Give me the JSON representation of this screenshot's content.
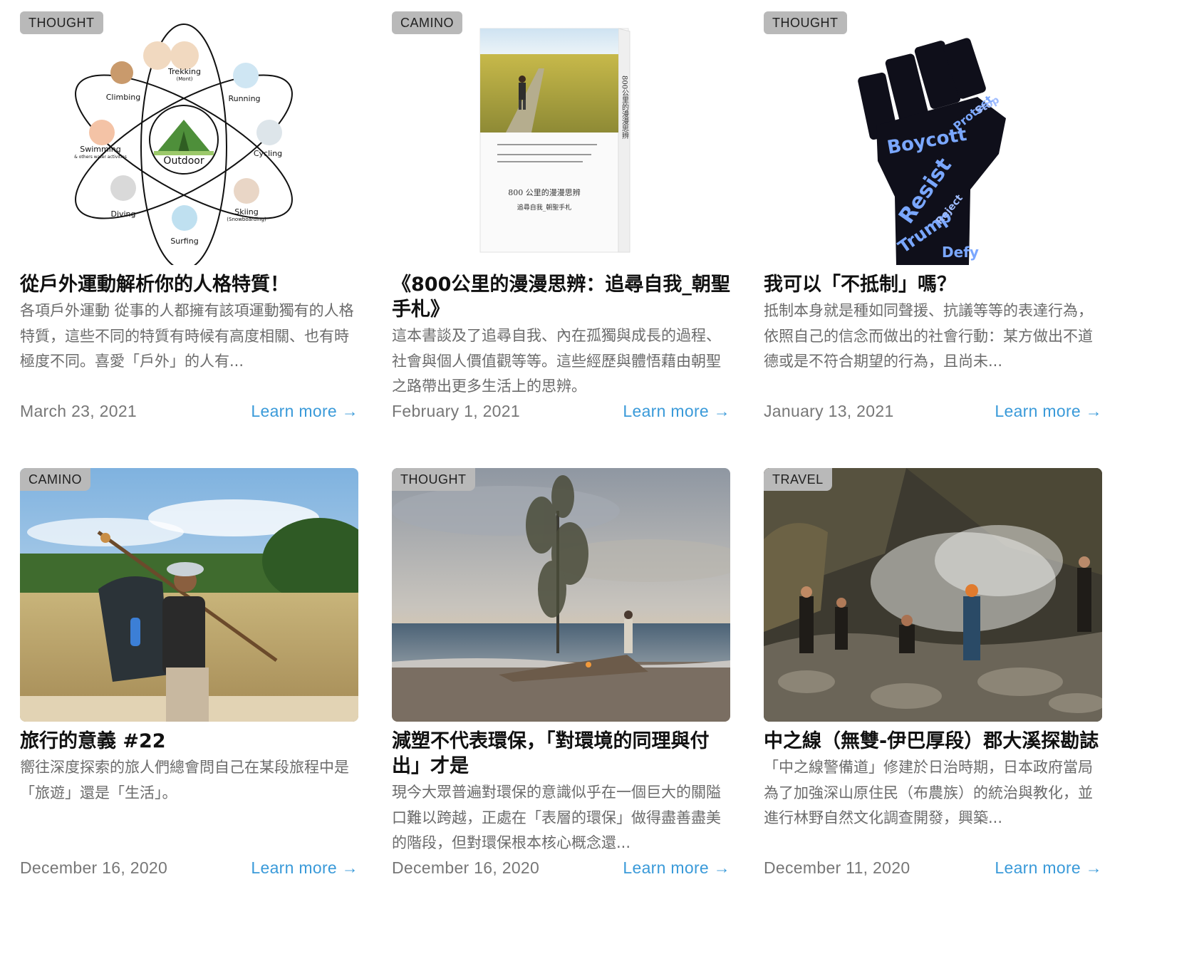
{
  "posts": [
    {
      "category": "THOUGHT",
      "title": "從戶外運動解析你的人格特質！",
      "excerpt": "各項戶外運動 從事的人都擁有該項運動獨有的人格特質，這些不同的特質有時候有高度相關、也有時極度不同。喜愛「戶外」的人有...",
      "date": "March 23, 2021",
      "link_label": "Learn more →",
      "image_labels": {
        "center": "Outdoor",
        "trekking": "Trekking",
        "trekking_sub": "(Mont)",
        "running": "Running",
        "cycling": "Cycling",
        "skiing": "Skiing",
        "skiing_sub": "(Snowboarding)",
        "surfing": "Surfing",
        "diving": "Diving",
        "swimming": "Swimming",
        "swimming_sub": "& others water activities",
        "climbing": "Climbing"
      }
    },
    {
      "category": "CAMINO",
      "title": "《800公里的漫漫思辨：追尋自我_朝聖手札》",
      "excerpt": "這本書談及了追尋自我、內在孤獨與成長的過程、社會與個人價值觀等等。這些經歷與體悟藉由朝聖之路帶出更多生活上的思辨。",
      "date": "February 1, 2021",
      "link_label": "Learn more →",
      "image_labels": {
        "book_title": "800 公里的漫漫思辨",
        "book_subtitle": "追尋自我_朝聖手札",
        "spine_text": "800公里的漫漫思辨"
      }
    },
    {
      "category": "THOUGHT",
      "title": "我可以「不抵制」嗎？",
      "excerpt": "抵制本身就是種如同聲援、抗議等等的表達行為，依照自己的信念而做出的社會行動：某方做出不道德或是不符合期望的行為，且尚未...",
      "date": "January 13, 2021",
      "link_label": "Learn more →",
      "image_labels": {
        "word1": "Boycott",
        "word2": "Resist",
        "word3": "Trump",
        "word4": "Defy",
        "word5": "Protest",
        "word6": "Reject",
        "word7": "Stop"
      }
    },
    {
      "category": "CAMINO",
      "title": "旅行的意義 #22",
      "excerpt": "嚮往深度探索的旅人們總會問自己在某段旅程中是「旅遊」還是「生活」。",
      "date": "December 16, 2020",
      "link_label": "Learn more →"
    },
    {
      "category": "THOUGHT",
      "title": "減塑不代表環保，「對環境的同理與付出」才是",
      "excerpt": "現今大眾普遍對環保的意識似乎在一個巨大的關隘口難以跨越，正處在「表層的環保」做得盡善盡美的階段，但對環保根本核心概念還...",
      "date": "December 16, 2020",
      "link_label": "Learn more →"
    },
    {
      "category": "TRAVEL",
      "title": "中之線（無雙-伊巴厚段）郡大溪探勘誌",
      "excerpt": "「中之線警備道」修建於日治時期，日本政府當局為了加強深山原住民（布農族）的統治與教化，並進行林野自然文化調查開發，興築...",
      "date": "December 11, 2020",
      "link_label": "Learn more →"
    }
  ],
  "colors": {
    "link": "#3a9ad9",
    "tag_bg": "#b9b9b9",
    "muted": "#6b6b6b"
  }
}
